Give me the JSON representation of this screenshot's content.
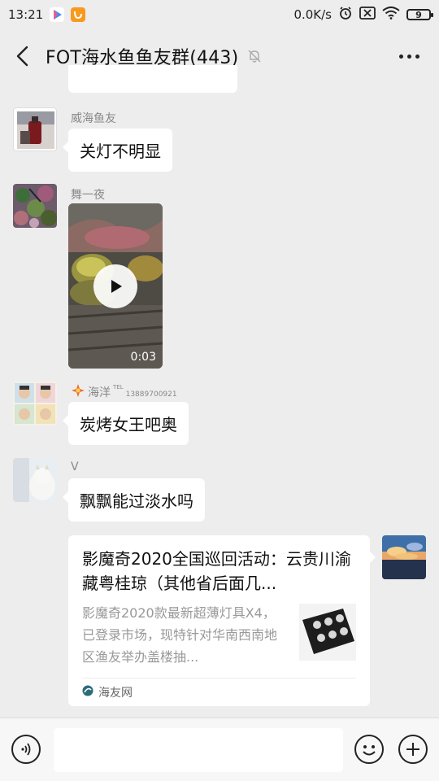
{
  "status_bar": {
    "time": "13:21",
    "network_speed": "0.0K/s",
    "battery": "9",
    "icons": [
      "video-app-icon",
      "uc-browser-icon",
      "alarm-icon",
      "no-sim-icon",
      "wifi-icon",
      "battery-icon"
    ]
  },
  "header": {
    "title": "FOT海水鱼鱼友群(443)",
    "icons": [
      "back-icon",
      "mute-icon",
      "more-icon"
    ]
  },
  "messages": [
    {
      "nickname": "威海鱼友",
      "text": "关灯不明显"
    },
    {
      "nickname": "舞一夜",
      "video_duration": "0:03"
    },
    {
      "nickname": "海洋",
      "nickname_suffix": "TEL",
      "phone": "13889700921",
      "text": "炭烤女王吧奥"
    },
    {
      "nickname": "V",
      "text": "飘飘能过淡水吗"
    }
  ],
  "link_card": {
    "title": "影魔奇2020全国巡回活动：云贵川渝藏粤桂琼（其他省后面几...",
    "description": "影魔奇2020款最新超薄灯具X4，已登录市场，现特针对华南西南地区渔友举办盖楼抽...",
    "source": "海友网"
  },
  "input_bar": {
    "placeholder": "",
    "icons": [
      "voice-icon",
      "emoji-icon",
      "plus-icon"
    ]
  }
}
